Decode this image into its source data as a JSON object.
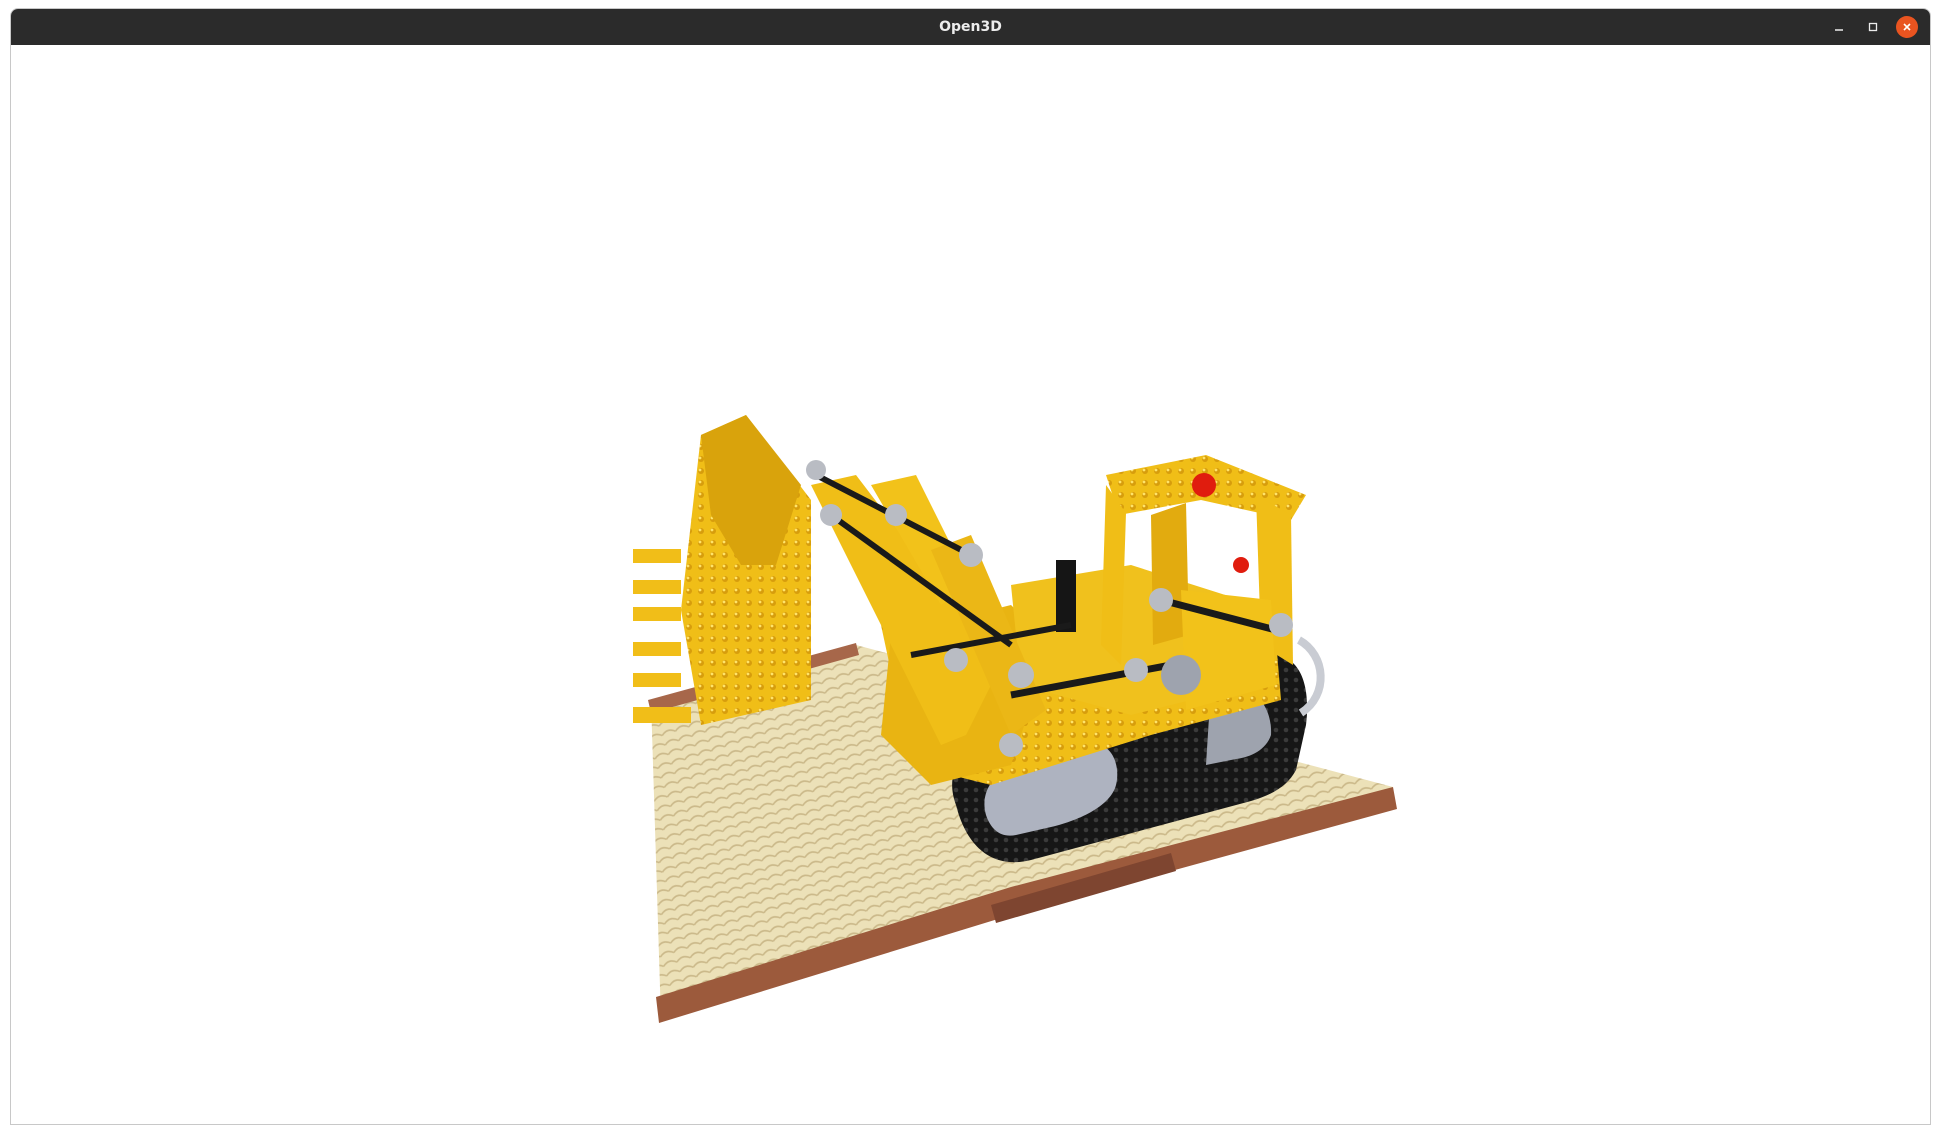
{
  "window": {
    "title": "Open3D",
    "controls": {
      "minimize_icon": "minimize-icon",
      "maximize_icon": "maximize-icon",
      "close_icon": "close-icon"
    },
    "colors": {
      "titlebar_bg": "#2b2b2b",
      "close_accent": "#e95420",
      "viewport_bg": "#ffffff"
    }
  },
  "scene": {
    "content": "point-cloud-model",
    "colors": {
      "body_yellow": "#f2c21a",
      "track_black": "#1a1a1a",
      "platform_tan": "#e9dcb0",
      "platform_edge": "#9c5a3c",
      "joint_gray": "#b9bcc3",
      "beacon_red": "#e01c0e"
    }
  }
}
